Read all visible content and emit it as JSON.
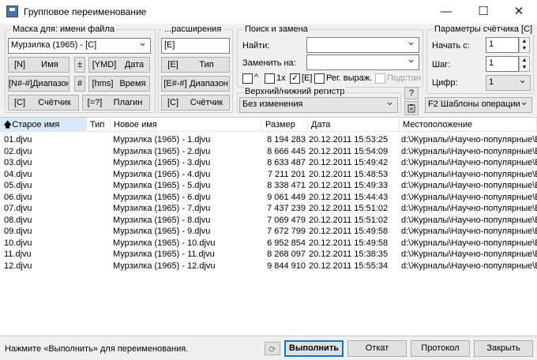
{
  "window": {
    "title": "Групповое переименование",
    "minimize": "—",
    "maximize": "☐",
    "close": "✕"
  },
  "mask_group": {
    "label": "Маска для: имени файла",
    "value": "Мурзилка (1965) - [C]",
    "buttons": [
      {
        "a": "[N]",
        "b": "Имя"
      },
      {
        "a": "±",
        "b": ""
      },
      {
        "a": "[YMD]",
        "b": "Дата"
      },
      {
        "a": "[N#-#]",
        "b": "Диапазон"
      },
      {
        "a": "#",
        "b": ""
      },
      {
        "a": "[hms]",
        "b": "Время"
      },
      {
        "a": "[C]",
        "b": "Счётчик"
      },
      {
        "a": "[=?]",
        "b": "Плагин"
      }
    ]
  },
  "ext_group": {
    "label": "...расширения",
    "value": "[E]",
    "buttons": [
      {
        "a": "[E]",
        "b": "Тип"
      },
      {
        "a": "[E#-#]",
        "b": "Диапазон"
      },
      {
        "a": "[C]",
        "b": "Счётчик"
      }
    ]
  },
  "search_group": {
    "label": "Поиск и замена",
    "find_label": "Найти:",
    "find_value": "",
    "replace_label": "Заменить на:",
    "replace_value": "",
    "opt_caret": "^",
    "opt_1x": "1x",
    "opt_e": "[E]",
    "opt_regex": "Рег. выраж.",
    "opt_subst": "Подстан",
    "opt_e_checked": "✓"
  },
  "case_group": {
    "label": "Верхний/нижний регистр",
    "value": "Без изменения",
    "help": "?"
  },
  "counter_group": {
    "label": "Параметры счётчика [C]",
    "start_label": "Начать с:",
    "start_value": "1",
    "step_label": "Шаг:",
    "step_value": "1",
    "digits_label": "Цифр:",
    "digits_value": "1",
    "templates": "F2 Шаблоны операции"
  },
  "table": {
    "columns": [
      "Старое имя",
      "Тип",
      "Новое имя",
      "Размер",
      "Дата",
      "Местоположение"
    ],
    "sort_arrow": "🡅",
    "rows": [
      [
        "01.djvu",
        "",
        "Мурзилка (1965) - 1.djvu",
        "8 194 283",
        "20.12.2011 15:53:25",
        "d:\\Журналы\\Научно-популярные\\Е"
      ],
      [
        "02.djvu",
        "",
        "Мурзилка (1965) - 2.djvu",
        "8 666 445",
        "20.12.2011 15:54:09",
        "d:\\Журналы\\Научно-популярные\\Е"
      ],
      [
        "03.djvu",
        "",
        "Мурзилка (1965) - 3.djvu",
        "8 633 487",
        "20.12.2011 15:49:42",
        "d:\\Журналы\\Научно-популярные\\Е"
      ],
      [
        "04.djvu",
        "",
        "Мурзилка (1965) - 4.djvu",
        "7 211 201",
        "20.12.2011 15:48:53",
        "d:\\Журналы\\Научно-популярные\\Е"
      ],
      [
        "05.djvu",
        "",
        "Мурзилка (1965) - 5.djvu",
        "8 338 471",
        "20.12.2011 15:49:33",
        "d:\\Журналы\\Научно-популярные\\Е"
      ],
      [
        "06.djvu",
        "",
        "Мурзилка (1965) - 6.djvu",
        "9 061 449",
        "20.12.2011 15:44:43",
        "d:\\Журналы\\Научно-популярные\\Е"
      ],
      [
        "07.djvu",
        "",
        "Мурзилка (1965) - 7.djvu",
        "7 437 239",
        "20.12.2011 15:51:02",
        "d:\\Журналы\\Научно-популярные\\Е"
      ],
      [
        "08.djvu",
        "",
        "Мурзилка (1965) - 8.djvu",
        "7 069 479",
        "20.12.2011 15:51:02",
        "d:\\Журналы\\Научно-популярные\\Е"
      ],
      [
        "09.djvu",
        "",
        "Мурзилка (1965) - 9.djvu",
        "7 672 799",
        "20.12.2011 15:49:58",
        "d:\\Журналы\\Научно-популярные\\Е"
      ],
      [
        "10.djvu",
        "",
        "Мурзилка (1965) - 10.djvu",
        "6 952 854",
        "20.12.2011 15:49:58",
        "d:\\Журналы\\Научно-популярные\\Е"
      ],
      [
        "11.djvu",
        "",
        "Мурзилка (1965) - 11.djvu",
        "8 268 097",
        "20.12.2011 15:38:35",
        "d:\\Журналы\\Научно-популярные\\Е"
      ],
      [
        "12.djvu",
        "",
        "Мурзилка (1965) - 12.djvu",
        "9 844 910",
        "20.12.2011 15:55:34",
        "d:\\Журналы\\Научно-популярные\\Е"
      ]
    ]
  },
  "status": {
    "text": "Нажмите «Выполнить» для переименования.",
    "run": "Выполнить",
    "undo": "Откат",
    "log": "Протокол",
    "close": "Закрыть"
  }
}
